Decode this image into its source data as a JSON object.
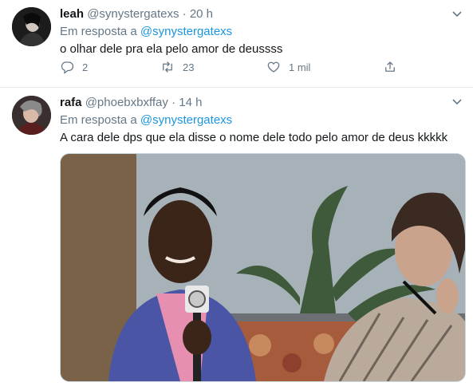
{
  "tweets": [
    {
      "name": "leah",
      "handle": "@synystergatexs",
      "time": "20 h",
      "reply_prefix": "Em resposta a",
      "reply_to": "@synystergatexs",
      "text": "o olhar dele pra ela pelo amor de deussss",
      "actions": {
        "replies": "2",
        "retweets": "23",
        "likes": "1 mil"
      }
    },
    {
      "name": "rafa",
      "handle": "@phoebxbxffay",
      "time": "14 h",
      "reply_prefix": "Em resposta a",
      "reply_to": "@synystergatexs",
      "text": "A cara dele dps que ela disse o nome dele todo pelo amor de deus kkkkk"
    }
  ],
  "separator": "·",
  "icons": {
    "reply": "reply-icon",
    "retweet": "retweet-icon",
    "like": "like-icon",
    "share": "share-icon",
    "more": "chevron-down-icon"
  },
  "colors": {
    "link": "#1b95e0",
    "secondary_text": "#657786",
    "divider": "#e6ecf0"
  }
}
